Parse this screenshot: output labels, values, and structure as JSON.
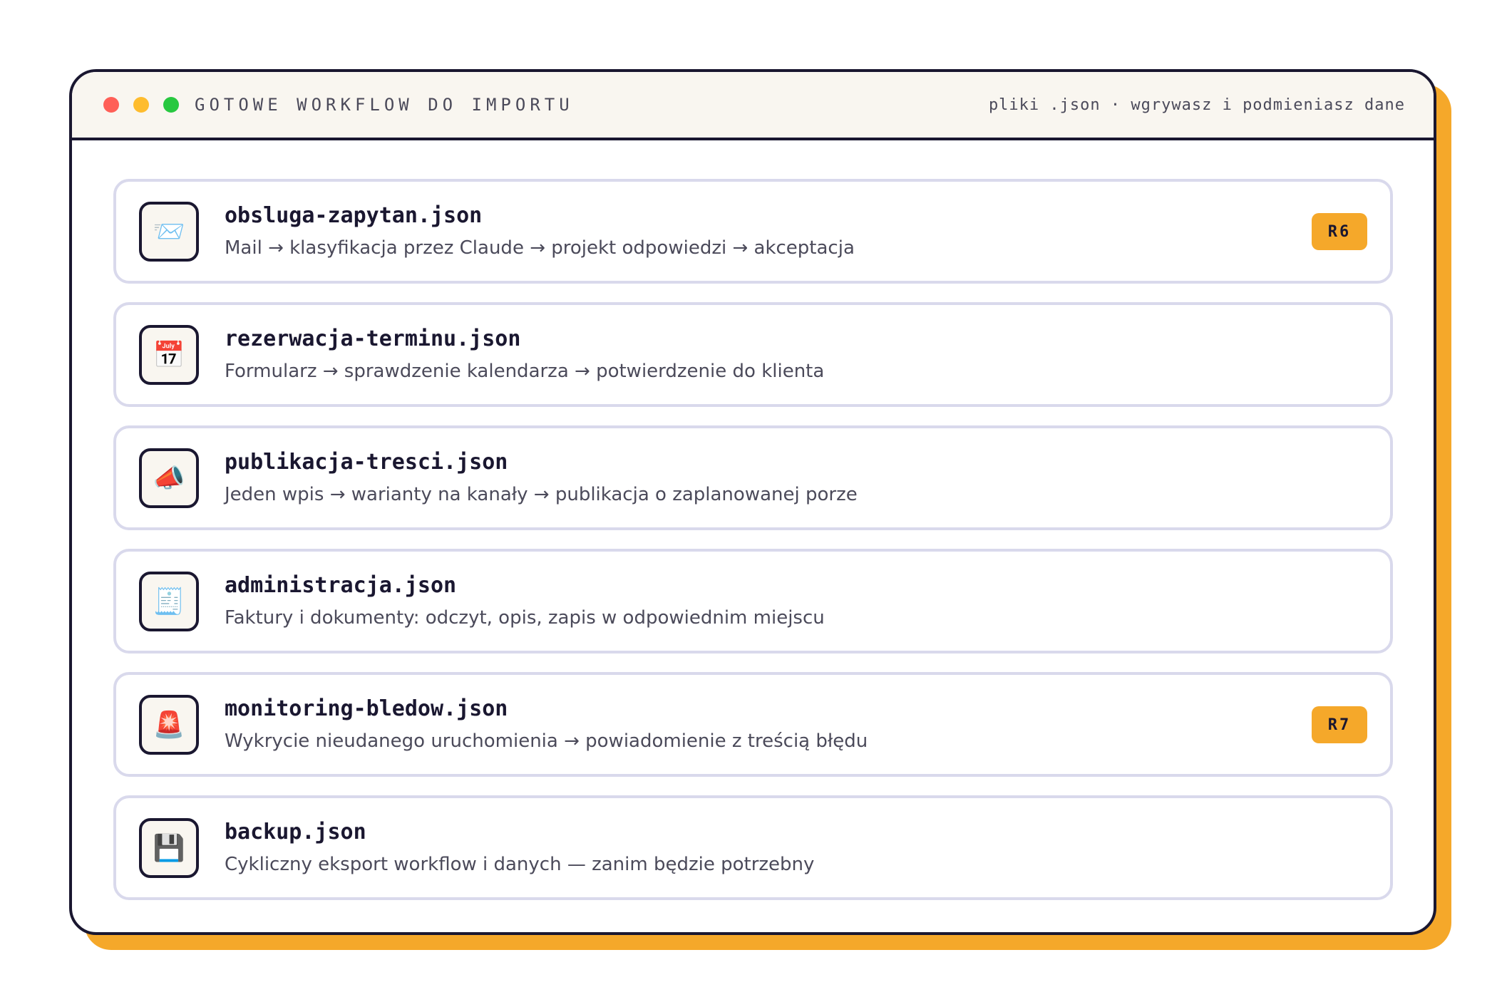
{
  "window": {
    "title": "GOTOWE WORKFLOW DO IMPORTU",
    "subtitle": "pliki .json · wgrywasz i podmieniasz dane"
  },
  "items": [
    {
      "icon": "envelope-icon",
      "glyph": "📨",
      "name": "obsluga-zapytan.json",
      "description": "Mail → klasyfikacja przez Claude → projekt odpowiedzi → akceptacja",
      "badge": "R6"
    },
    {
      "icon": "calendar-icon",
      "glyph": "📅",
      "name": "rezerwacja-terminu.json",
      "description": "Formularz → sprawdzenie kalendarza → potwierdzenie do klienta",
      "badge": ""
    },
    {
      "icon": "megaphone-icon",
      "glyph": "📣",
      "name": "publikacja-tresci.json",
      "description": "Jeden wpis → warianty na kanały → publikacja o zaplanowanej porze",
      "badge": ""
    },
    {
      "icon": "receipt-icon",
      "glyph": "🧾",
      "name": "administracja.json",
      "description": "Faktury i dokumenty: odczyt, opis, zapis w odpowiednim miejscu",
      "badge": ""
    },
    {
      "icon": "siren-icon",
      "glyph": "🚨",
      "name": "monitoring-bledow.json",
      "description": "Wykrycie nieudanego uruchomienia → powiadomienie z treścią błędu",
      "badge": "R7"
    },
    {
      "icon": "floppy-disk-icon",
      "glyph": "💾",
      "name": "backup.json",
      "description": "Cykliczny eksport workflow i danych — zanim będzie potrzebny",
      "badge": ""
    }
  ],
  "colors": {
    "accent": "#f5a82a",
    "border": "#1a1730",
    "item_border": "#d9d9ec",
    "titlebar_bg": "#f9f6f0"
  }
}
